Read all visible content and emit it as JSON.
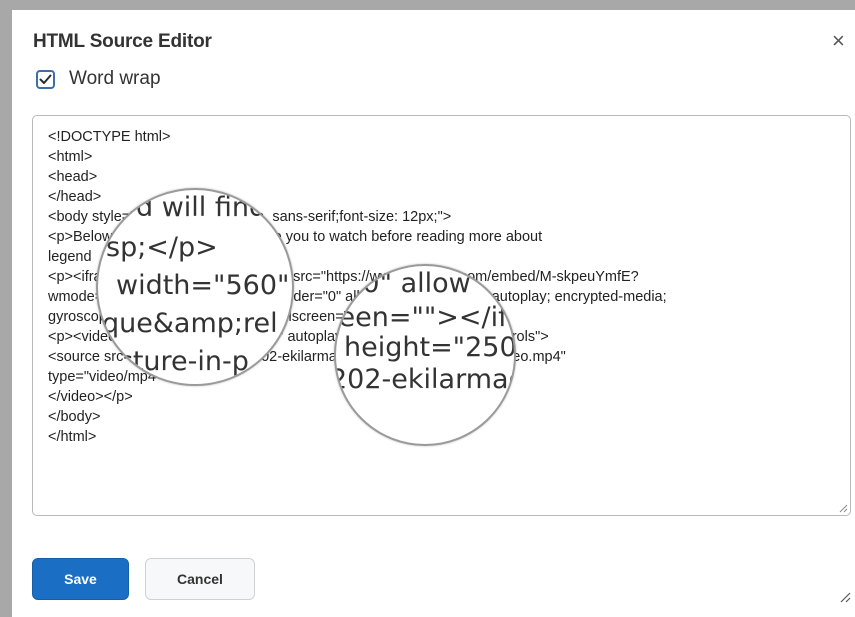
{
  "dialog": {
    "title": "HTML Source Editor",
    "close_glyph": "×",
    "word_wrap": {
      "label": "Word wrap",
      "checked": true
    },
    "buttons": {
      "save": "Save",
      "cancel": "Cancel"
    }
  },
  "editor": {
    "lines": [
      "<!DOCTYPE html>",
      "<html>",
      "<head>",
      "</head>",
      "<body style=\"font-family: Verdana, sans-serif;font-size: 12px;\">",
      "<p>Below is a video that I would like you to watch before reading more about",
      "legend",
      "<p><iframe width=\"560\" height=\"315\" src=\"https://www.youtube.com/embed/M-skpeuYmfE?",
      "wmode=opaque&amp;rel=0\" frameborder=\"0\" allow=\"accelerometer; autoplay; encrypted-media;",
      "gyroscope; picture-in-picture\" allowfullscreen=\"\"></iframe></p>",
      "<p><video width=\"560\" height=\"250\" autoplay=\"autoplay\" controls=\"controls\">",
      "      <source src=\"/content/enforced/202-ekilarmage/box/My presentation Video.mp4\"",
      "type=\"video/mp4\" />",
      "</video></p>",
      "</body>",
      "</html>"
    ]
  },
  "magnifiers": {
    "left": [
      "d will find",
      "sp;</p>",
      "width=\"560\"",
      "que&amp;rel",
      "cture-in-p"
    ],
    "right": [
      "\"0\" allow",
      "reen=\"\"></if",
      "height=\"250\"",
      "202-ekilarmag"
    ]
  }
}
